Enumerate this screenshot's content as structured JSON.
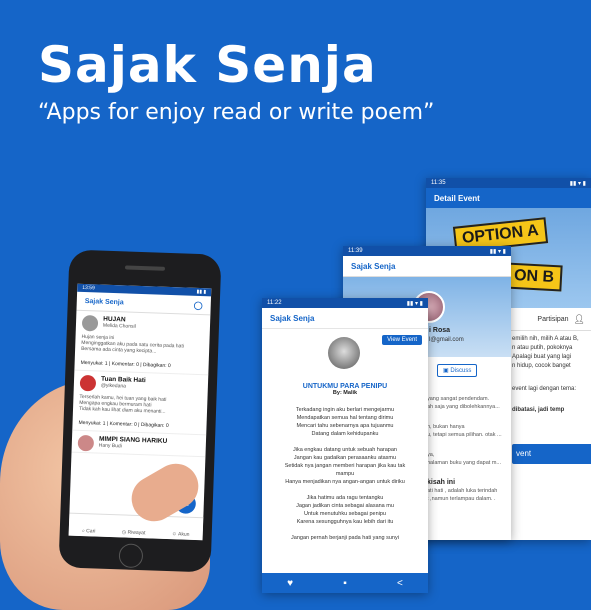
{
  "hero": {
    "title": "Sajak Senja",
    "subtitle": "“Apps for enjoy read or write poem”"
  },
  "colors": {
    "background": "#1565c8",
    "primary": "#1565c8",
    "statusbar": "#1150a8"
  },
  "detail_screen": {
    "time": "11:35",
    "title": "Detail Event",
    "signs": [
      "OPTION A",
      "ON B"
    ],
    "tab_label": "Partisipan",
    "text_lines": [
      "emilih nih, milih A atau B,",
      "n atau putih, pokoknya",
      "Apalagi buat yang lagi",
      "n hidup, cocok banget"
    ],
    "event_line": "event lagi dengan tema:",
    "limit_line": "dibatasi, jadi temp",
    "button_label": "vent"
  },
  "profile_screen": {
    "time": "11:39",
    "title": "Sajak Senja",
    "name": "i Rosa",
    "email": "l@gmail.com",
    "discuss_label": "Discuss",
    "lines": [
      "yang sangat pendendam.",
      "ah saja yang dibolehkannya...",
      "h, bukan hanya",
      "u, tetapi semua pilihan. otak ...",
      "ya,",
      "halaman buku yang dapat m..."
    ],
    "section_title": "kisah ini",
    "section_lines": [
      "ati hati , adalah luka terindah",
      "t ,namun terlampau dalam. ."
    ]
  },
  "poem_screen": {
    "time": "11:22",
    "title": "Sajak Senja",
    "view_event": "View Event",
    "poem_title": "UNTUKMU PARA PENIPU",
    "author": "By: Malik",
    "stanzas": [
      [
        "Terkadang ingin aku berlari mengejarmu",
        "Mendapatkan semua hal tentang dirimu",
        "Mencari tahu sebenarnya apa tujuanmu",
        "Datang dalam kehidupanku"
      ],
      [
        "Jika engkau datang untuk sebuah harapan",
        "Jangan kau gadaikan perasaanku atasmu",
        "Setidak nya jangan memberi harapan jika kau tak",
        "mampu",
        "Hanya menjadikan nya angan-angan untuk diriku"
      ],
      [
        "Jika hatimu ada ragu tentangku",
        "Jagan jadikan cinta sebagai alasana mu",
        "Untuk menutuhku sebagai penipu",
        "Karena sesungguhnya kau lebih dari itu"
      ],
      [
        "Jangan pernah berjanji pada hati yang sunyi"
      ]
    ],
    "nav_icons": [
      "heart-icon",
      "comment-icon",
      "share-icon"
    ]
  },
  "phone_screen": {
    "time": "13:59",
    "title": "Sajak Senja",
    "items": [
      {
        "title": "HUJAN",
        "author": "Melida Chonsil",
        "snippet": [
          "Hujan senja ini",
          "Menginggatkan aku pada satu cerita pada hati",
          "Bersama ada cinta yang kecipta..."
        ],
        "stats": "Menyukai: 1 | Komentar: 0 | Dibagikan: 0"
      },
      {
        "title": "Tuan Baik Hati",
        "author": "@yikedana",
        "snippet": [
          "Terserlah kamu, hei tuan yang baik hati",
          "Mengapa engkau bermuram hati",
          "Tidak kah kau lihat diam aku menanti..."
        ],
        "stats": "Menyukai: 1 | Komentar: 0 | Dibagikan: 0"
      },
      {
        "title": "MIMPI SIANG HARIKU",
        "author": "Hany Budi",
        "snippet": [],
        "stats": ""
      }
    ],
    "nav": [
      "Cari",
      "Riwayat",
      "Akun"
    ]
  }
}
